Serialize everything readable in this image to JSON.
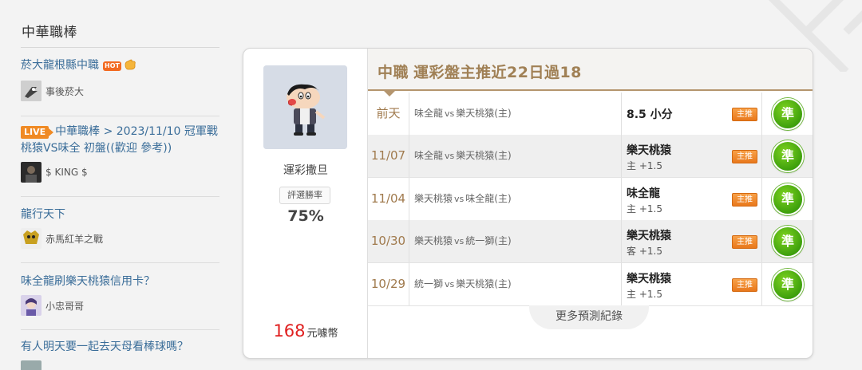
{
  "sidebar": {
    "title": "中華職棒",
    "posts": [
      {
        "title": "菸大龍根縣中職",
        "hot": "HOT",
        "author": "事後菸大"
      },
      {
        "live": "LIVE",
        "title": "中華職棒 > 2023/11/10 冠軍戰 桃猿VS味全 初盤((歡迎 參考))",
        "author": "$ KING $"
      },
      {
        "title": "龍行天下",
        "author": "赤馬紅羊之戰"
      },
      {
        "title": "味全龍刷樂天桃猿信用卡？",
        "author": "小忠哥哥"
      },
      {
        "title": "有人明天要一起去天母看棒球嗎？"
      }
    ]
  },
  "profile": {
    "name": "運彩撒旦",
    "rate_label": "評選勝率",
    "rate_value": "75%",
    "price": "168",
    "price_unit": "元噱幣"
  },
  "records": {
    "title_league": "中職",
    "title_main": "運彩盤主推近22日過18",
    "rows": [
      {
        "date": "前天",
        "away": "味全龍",
        "vs": "vs",
        "home": "樂天桃猿(主)",
        "pick": "8.5 小分",
        "pick_sub": "",
        "tag": "主推",
        "result": "準"
      },
      {
        "date": "11/07",
        "away": "味全龍",
        "vs": "vs",
        "home": "樂天桃猿(主)",
        "pick": "樂天桃猿",
        "pick_sub": "主 +1.5",
        "tag": "主推",
        "result": "準"
      },
      {
        "date": "11/04",
        "away": "樂天桃猿",
        "vs": "vs",
        "home": "味全龍(主)",
        "pick": "味全龍",
        "pick_sub": "主 +1.5",
        "tag": "主推",
        "result": "準"
      },
      {
        "date": "10/30",
        "away": "樂天桃猿",
        "vs": "vs",
        "home": "統一獅(主)",
        "pick": "樂天桃猿",
        "pick_sub": "客 +1.5",
        "tag": "主推",
        "result": "準"
      },
      {
        "date": "10/29",
        "away": "統一獅",
        "vs": "vs",
        "home": "樂天桃猿(主)",
        "pick": "樂天桃猿",
        "pick_sub": "主 +1.5",
        "tag": "主推",
        "result": "準"
      }
    ],
    "more_label": "更多預測紀錄"
  },
  "colors": {
    "link": "#3a6d99",
    "accent_gold": "#a08055",
    "price_red": "#e02020",
    "tag_orange": "#ee8a2a",
    "result_green": "#4caf1a"
  }
}
